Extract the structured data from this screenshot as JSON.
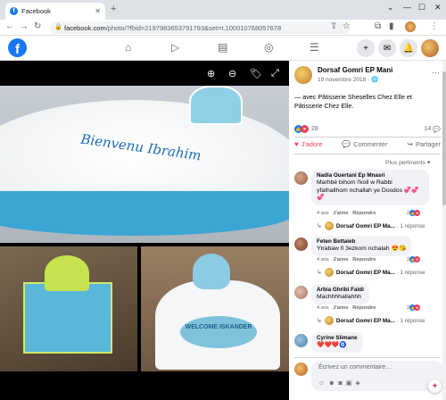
{
  "browser": {
    "tab_title": "Facebook",
    "tab_favicon": "f",
    "url_host": "facebook.com",
    "url_path": "/photo/?fbid=2197983653791793&set=t.100010768057678"
  },
  "fb": {
    "logo": "f"
  },
  "post": {
    "author": "Dorsaf Gomri EP Mani",
    "date": "19 novembre 2018 · ",
    "text": "— avec Pâtisserie Sheselles Chez Elle et Pâtisserie Chez Elle.",
    "reaction_count": "28",
    "comment_count": "14",
    "actions": {
      "like": "J'adore",
      "comment": "Commenter",
      "share": "Partager"
    },
    "sort_label": "Plus pertinents ▾"
  },
  "photo": {
    "cake_inscription": "Bienvenu Ibrahim",
    "plaque_text": "WELCOME ISKANDER"
  },
  "comments": [
    {
      "name": "Nadia Ouertani Ep Mnasri",
      "text": "Marhbé bihom l'koll w Rabbi yfathallhom nchallah ye Dosdos 💞💞💞",
      "age": "4 ans",
      "like": "J'aime",
      "reply": "Répondre",
      "reactions": "2",
      "reply_author": "Dorsaf Gomri EP Ma...",
      "reply_count": "· 1 réponse"
    },
    {
      "name": "Feten Bettaieb",
      "text": "Ytrabaw fi 3ezkom nchalah 😍😘",
      "age": "4 ans",
      "like": "J'aime",
      "reply": "Répondre",
      "reactions": "2",
      "reply_author": "Dorsaf Gomri EP Ma...",
      "reply_count": "· 1 réponse"
    },
    {
      "name": "Arbia Ghribi Faidi",
      "text": "Machhhhallahhh",
      "age": "4 ans",
      "like": "J'aime",
      "reply": "Répondre",
      "reactions": "2",
      "reply_author": "Dorsaf Gomri EP Ma...",
      "reply_count": "· 1 réponse"
    },
    {
      "name": "Cyrine Slimane",
      "text": "❤️❤️❤️🧿"
    }
  ],
  "compose": {
    "placeholder": "Écrivez un commentaire…"
  },
  "colors": {
    "brand": "#1877f2",
    "love": "#f33e58"
  }
}
